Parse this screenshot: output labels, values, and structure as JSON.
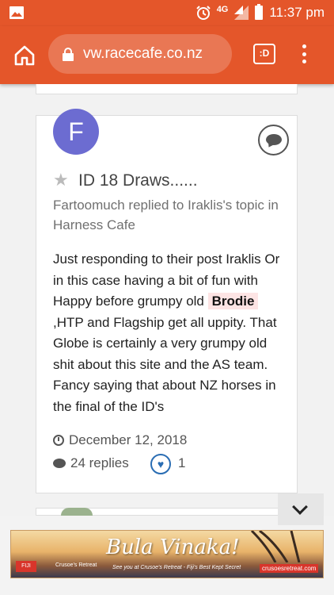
{
  "status_bar": {
    "network": "4G",
    "time": "11:37 pm",
    "icons": [
      "image-icon",
      "alarm-icon",
      "signal-icon",
      "battery-icon"
    ]
  },
  "browser": {
    "url": "vw.racecafe.co.nz",
    "tab_label": ":D",
    "icons": [
      "home-icon",
      "lock-icon",
      "tab-switcher-icon",
      "overflow-menu-icon"
    ],
    "accent_color": "#e4562a"
  },
  "post": {
    "avatar_letter": "F",
    "avatar_color": "#6c6cd1",
    "title": "ID 18 Draws......",
    "meta": "Fartoomuch replied to Iraklis's topic in Harness Cafe",
    "body_before": "Just responding to their post Iraklis Or in this case having a bit of fun with Happy before grumpy old ",
    "body_highlight": "Brodie",
    "body_after": " ,HTP and Flagship get all uppity. That Globe is certainly a very grumpy old shit about this site and the AS team. Fancy saying that about NZ horses in the final of the ID's",
    "date": "December 12, 2018",
    "replies": "24 replies",
    "likes": "1"
  },
  "ad": {
    "headline": "Bula Vinaka!",
    "brand": "Crusoe's Retreat",
    "tagline": "See you at Crusoe's Retreat - Fiji's Best Kept Secret",
    "url": "crusoesretreat.com",
    "logo_text": "FIJI"
  }
}
